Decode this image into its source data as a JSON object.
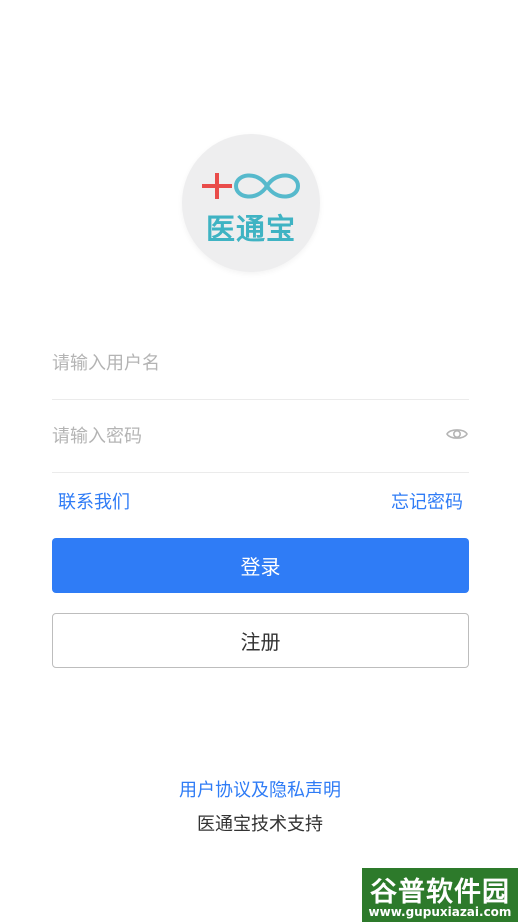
{
  "logo": {
    "text": "医通宝",
    "text_color": "#3fb3c3",
    "plus_color": "#e94c4a",
    "infinity_color": "#56b9cc"
  },
  "login_form": {
    "username_placeholder": "请输入用户名",
    "password_placeholder": "请输入密码",
    "password_visibility_icon": "eye-icon"
  },
  "links": {
    "contact_us": "联系我们",
    "forgot_password": "忘记密码"
  },
  "buttons": {
    "login": "登录",
    "register": "注册"
  },
  "footer": {
    "agreement": "用户协议及隐私声明",
    "support": "医通宝技术支持"
  },
  "watermark": {
    "main": "谷普软件园",
    "url": "www.gupuxiazai.com"
  },
  "colors": {
    "accent": "#2f7cf6",
    "watermark_bg": "#2d7a2b"
  }
}
